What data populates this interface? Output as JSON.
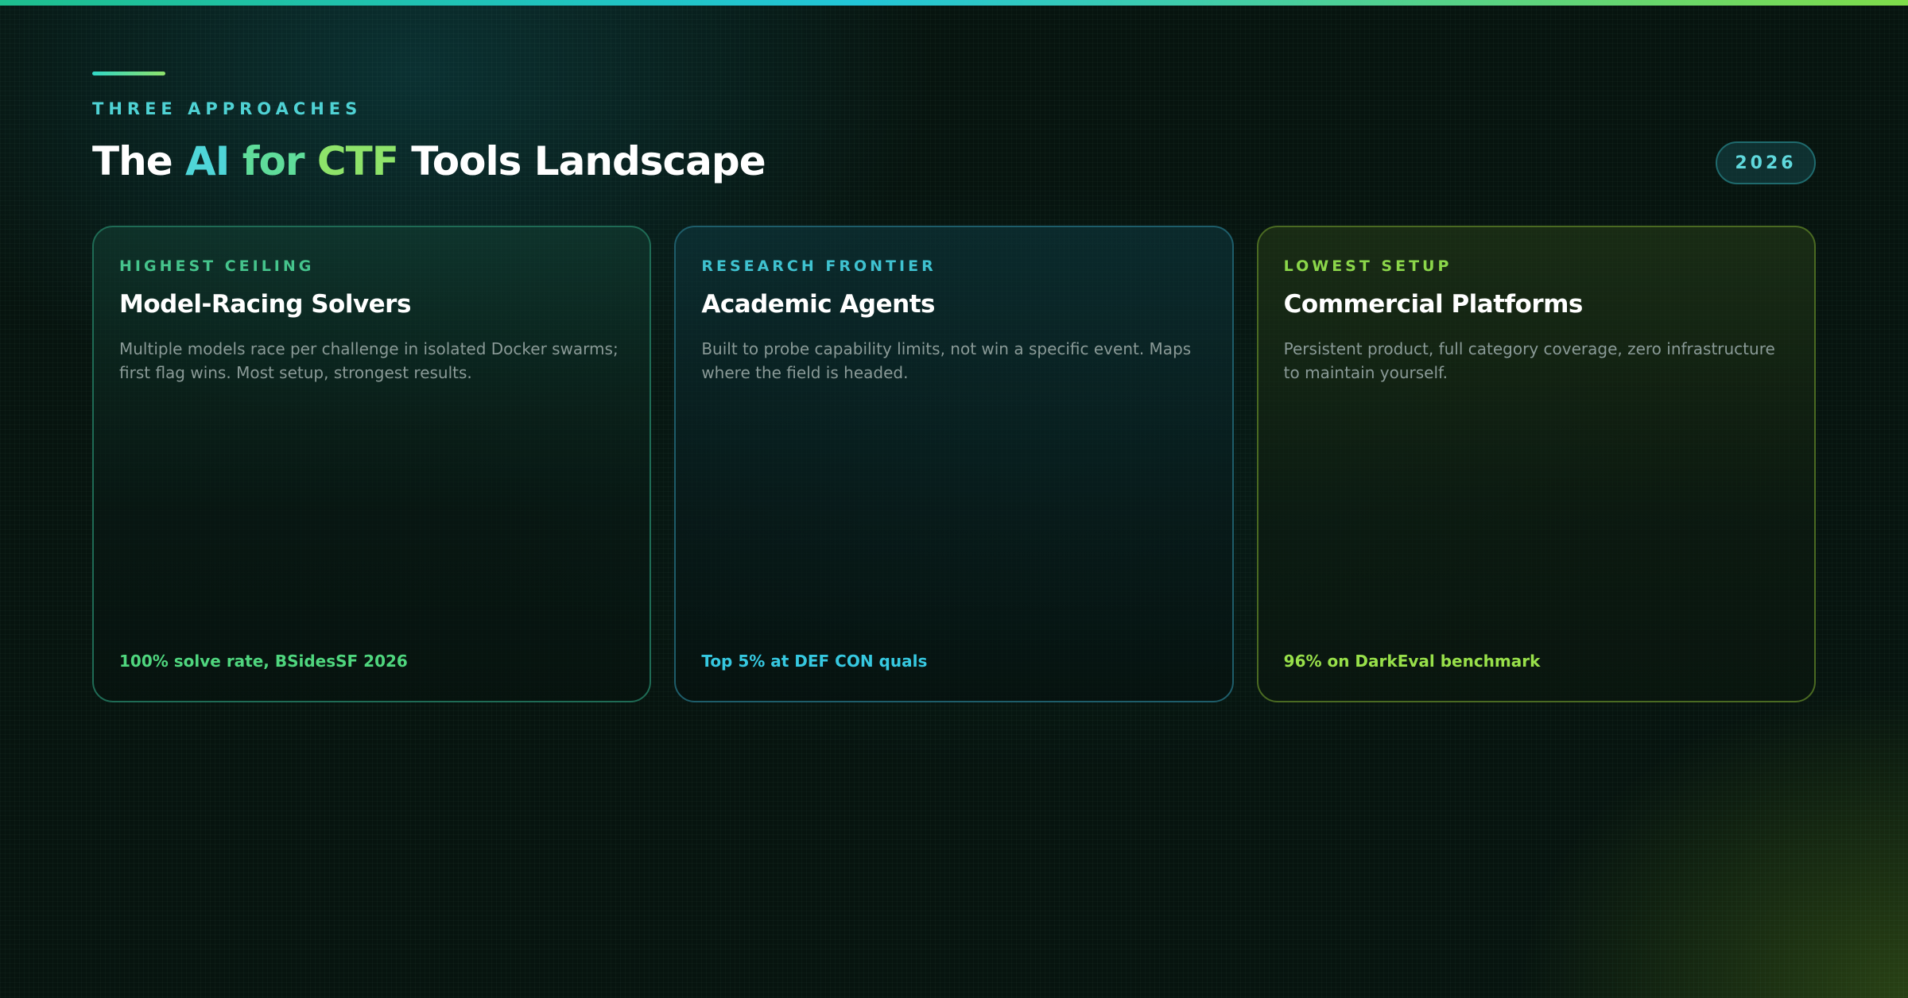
{
  "header": {
    "eyebrow": "THREE APPROACHES",
    "title": {
      "part1": "The ",
      "highlight_ai": "AI",
      "highlight_for": " for ",
      "highlight_ctf": "CTF",
      "part2": " Tools Landscape"
    },
    "year_badge": "2026"
  },
  "cards": [
    {
      "kicker": "HIGHEST CEILING",
      "title": "Model-Racing Solvers",
      "description": "Multiple models race per challenge in isolated Docker swarms; first flag wins. Most setup, strongest results.",
      "stat": "100% solve rate, BSidesSF 2026"
    },
    {
      "kicker": "RESEARCH FRONTIER",
      "title": "Academic Agents",
      "description": "Built to probe capability limits, not win a specific event. Maps where the field is headed.",
      "stat": "Top 5% at DEF CON quals"
    },
    {
      "kicker": "LOWEST SETUP",
      "title": "Commercial Platforms",
      "description": "Persistent product, full category coverage, zero infrastructure to maintain yourself.",
      "stat": "96% on DarkEval benchmark"
    }
  ],
  "colors": {
    "background": "#07140f",
    "accent_teal": "#4fd6d8",
    "accent_green": "#5fdc9a",
    "accent_lime": "#8ee36a"
  }
}
